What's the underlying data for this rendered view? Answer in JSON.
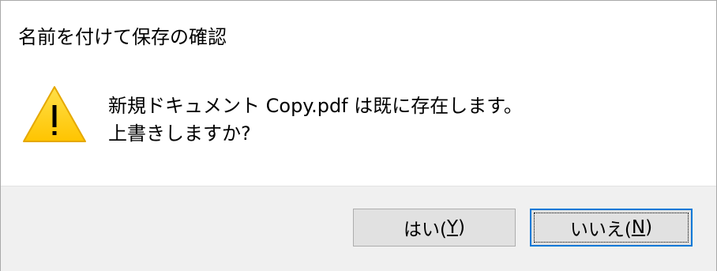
{
  "dialog": {
    "title": "名前を付けて保存の確認",
    "icon": "warning-icon",
    "message_line1": "新規ドキュメント Copy.pdf は既に存在します。",
    "message_line2": "上書きしますか?",
    "buttons": {
      "yes_label": "はい(",
      "yes_key": "Y",
      "yes_close": ")",
      "no_label": "いいえ(",
      "no_key": "N",
      "no_close": ")"
    },
    "colors": {
      "warning_fill": "#FFCC00",
      "warning_stroke": "#E5A800",
      "focus_border": "#0078D7",
      "footer_bg": "#F0F0F0"
    }
  }
}
